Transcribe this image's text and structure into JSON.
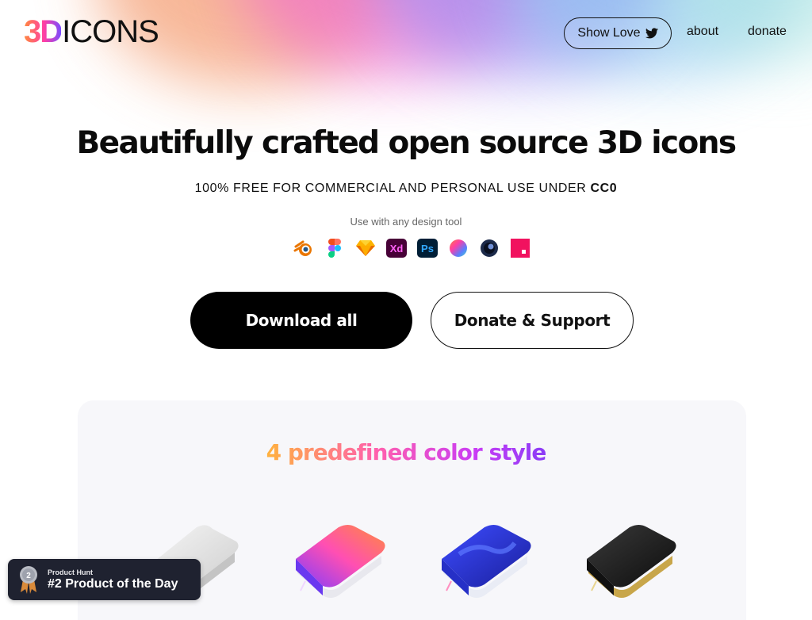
{
  "brand": {
    "logo_prefix": "3D",
    "logo_suffix": "ICONS"
  },
  "nav": {
    "show_love_label": "Show Love",
    "about_label": "about",
    "donate_label": "donate"
  },
  "hero": {
    "headline": "Beautifully crafted open source 3D icons",
    "subline_prefix": "100% FREE FOR COMMERCIAL AND PERSONAL USE UNDER ",
    "subline_license": "CC0",
    "tools_label": "Use with any design tool",
    "tools": [
      "blender-icon",
      "figma-icon",
      "sketch-icon",
      "xd-icon",
      "photoshop-icon",
      "color-sphere-icon",
      "cinema4d-icon",
      "craft-icon"
    ]
  },
  "actions": {
    "download_label": "Download all",
    "donate_label": "Donate & Support"
  },
  "styles_section": {
    "title": "4 predefined color style",
    "items": [
      "clay",
      "color",
      "gradient",
      "premium"
    ]
  },
  "product_hunt": {
    "source": "Product Hunt",
    "award": "#2 Product of the Day",
    "rank": "2"
  },
  "colors": {
    "primary": "#000000",
    "text": "#111111",
    "badge_bg": "#1f2230",
    "panel_bg": "#f7f7fa"
  }
}
